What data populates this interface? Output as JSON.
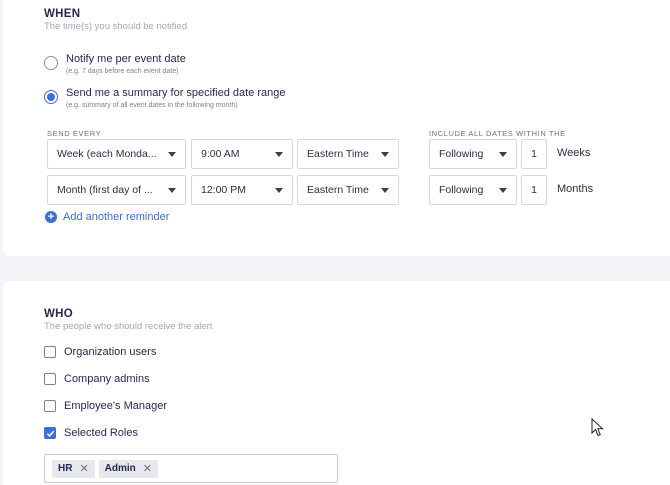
{
  "when": {
    "title": "WHEN",
    "subtitle": "The time(s) you should be notified",
    "options": [
      {
        "label": "Notify me per event date",
        "hint": "(e.g. 7 days before each event date)",
        "selected": false
      },
      {
        "label": "Send me a summary for specified date range",
        "hint": "(e.g. summary of all event dates in the following month)",
        "selected": true
      }
    ],
    "send_every_label": "SEND EVERY",
    "include_label": "INCLUDE ALL DATES WITHIN THE",
    "reminders": [
      {
        "frequency": "Week (each Monda...",
        "time": "9:00 AM",
        "timezone": "Eastern Time",
        "direction": "Following",
        "count": "1",
        "unit": "Weeks"
      },
      {
        "frequency": "Month (first day of ...",
        "time": "12:00 PM",
        "timezone": "Eastern Time",
        "direction": "Following",
        "count": "1",
        "unit": "Months"
      }
    ],
    "add_reminder": "Add another reminder"
  },
  "who": {
    "title": "WHO",
    "subtitle": "The people who should receive the alert",
    "checkboxes": [
      {
        "label": "Organization users",
        "checked": false
      },
      {
        "label": "Company admins",
        "checked": false
      },
      {
        "label": "Employee's Manager",
        "checked": false
      },
      {
        "label": "Selected Roles",
        "checked": true
      }
    ],
    "tags": [
      "HR",
      "Admin"
    ]
  },
  "colors": {
    "accent": "#3c6fe0",
    "link": "#3d6fd6",
    "title": "#262a52",
    "muted": "#a3a7b7"
  }
}
